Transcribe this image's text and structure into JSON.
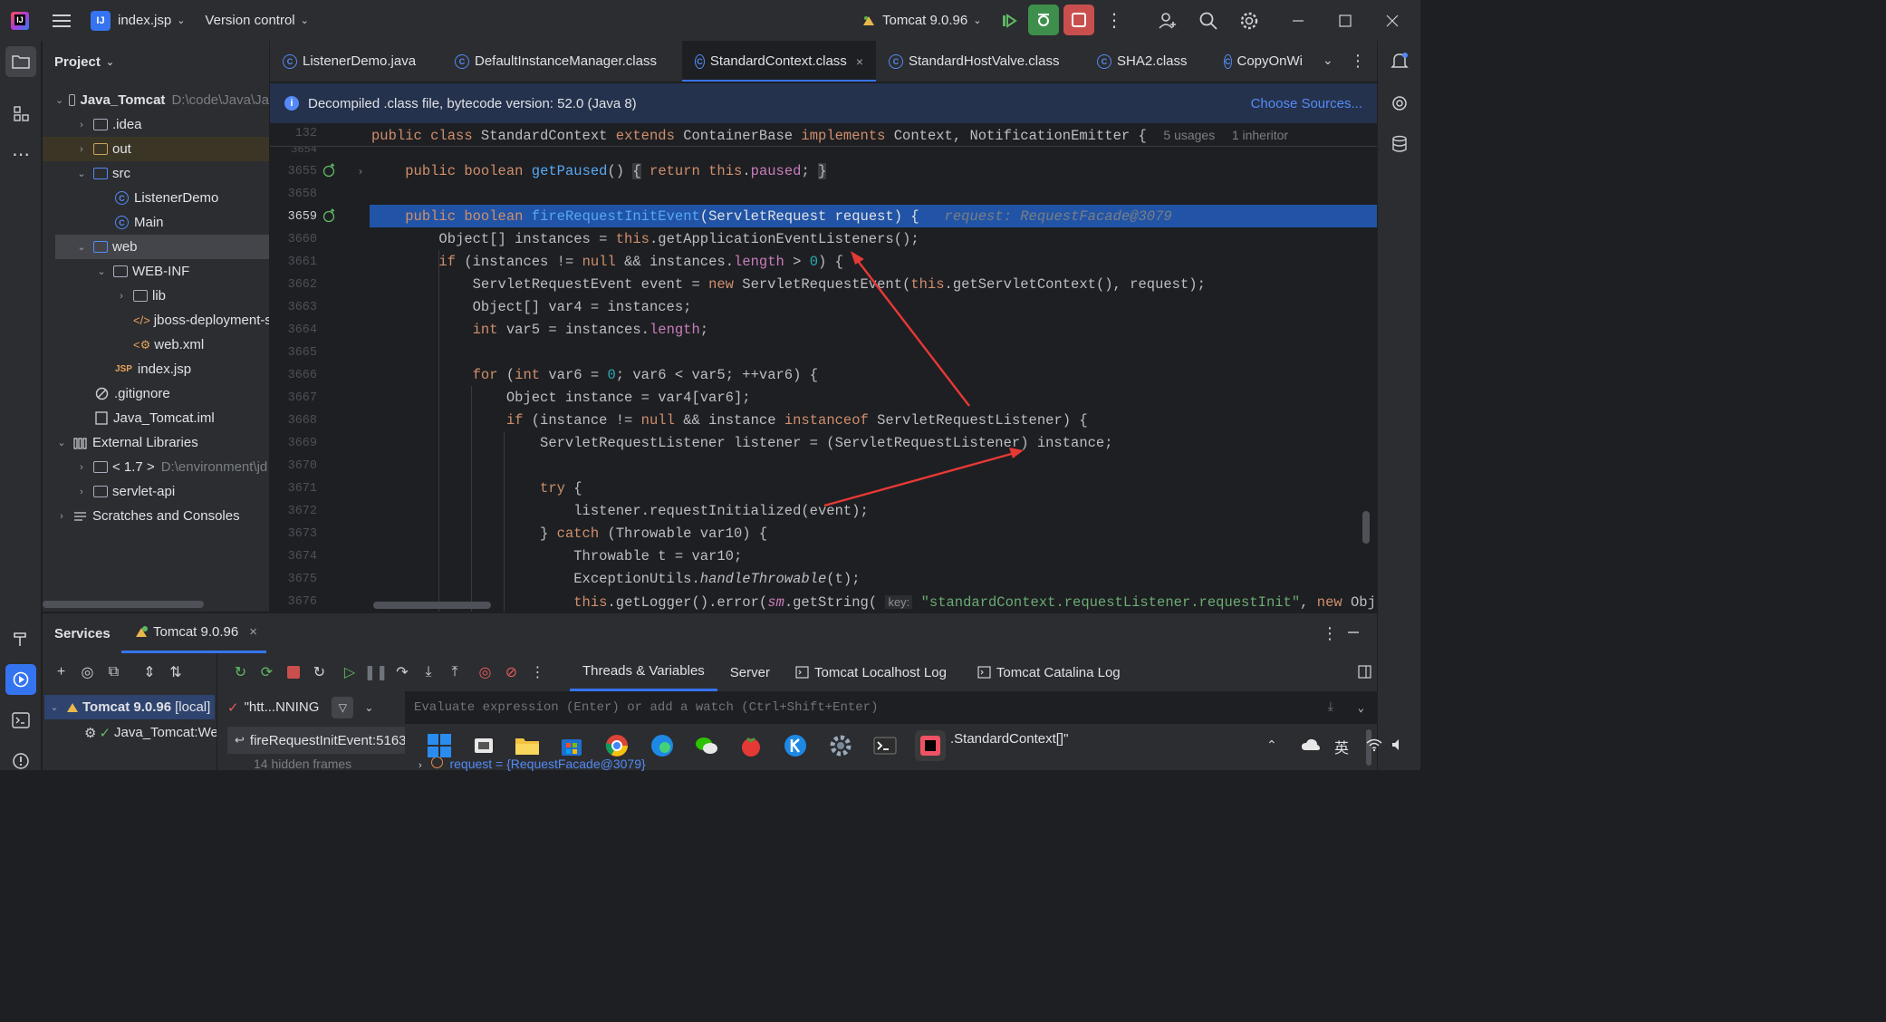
{
  "titlebar": {
    "project_name": "index.jsp",
    "project_badge": "IJ",
    "vcs_label": "Version control",
    "run_config": "Tomcat 9.0.96"
  },
  "project_panel": {
    "title": "Project",
    "items": [
      {
        "label": "Java_Tomcat",
        "path": "D:\\code\\Java\\Ja"
      },
      {
        "label": ".idea"
      },
      {
        "label": "out"
      },
      {
        "label": "src"
      },
      {
        "label": "ListenerDemo"
      },
      {
        "label": "Main"
      },
      {
        "label": "web"
      },
      {
        "label": "WEB-INF"
      },
      {
        "label": "lib"
      },
      {
        "label": "jboss-deployment-s"
      },
      {
        "label": "web.xml"
      },
      {
        "label": "index.jsp"
      },
      {
        "label": ".gitignore"
      },
      {
        "label": "Java_Tomcat.iml"
      },
      {
        "label": "External Libraries"
      },
      {
        "label": "< 1.7 >",
        "path": "D:\\environment\\jd"
      },
      {
        "label": "servlet-api"
      },
      {
        "label": "Scratches and Consoles"
      }
    ]
  },
  "tabs": [
    {
      "label": "ListenerDemo.java"
    },
    {
      "label": "DefaultInstanceManager.class"
    },
    {
      "label": "StandardContext.class"
    },
    {
      "label": "StandardHostValve.class"
    },
    {
      "label": "SHA2.class"
    },
    {
      "label": "CopyOnWi"
    }
  ],
  "banner": {
    "text": "Decompiled .class file, bytecode version: 52.0 (Java 8)",
    "link": "Choose Sources..."
  },
  "sticky": {
    "line_number": "132",
    "usages": "5 usages",
    "inheritor": "1 inheritor"
  },
  "line_numbers": [
    "3654",
    "3655",
    "3658",
    "3659",
    "3660",
    "3661",
    "3662",
    "3663",
    "3664",
    "3665",
    "3666",
    "3667",
    "3668",
    "3669",
    "3670",
    "3671",
    "3672",
    "3673",
    "3674",
    "3675",
    "3676"
  ],
  "inline_hint": "request: RequestFacade@3079",
  "param_hint": "key:",
  "string_literal": "\"standardContext.requestListener.requestInit\"",
  "services": {
    "title": "Services",
    "tab": "Tomcat 9.0.96",
    "tree_server": "Tomcat 9.0.96",
    "tree_server_suffix": "[local]",
    "tree_artifact": "Java_Tomcat:We",
    "thread_label": "\"htt...NNING",
    "frame": "fireRequestInitEvent:5163",
    "hidden_frames": "14 hidden frames",
    "tabs": [
      "Threads & Variables",
      "Server",
      "Tomcat Localhost Log",
      "Tomcat Catalina Log"
    ],
    "eval_placeholder": "Evaluate expression (Enter) or add a watch (Ctrl+Shift+Enter)",
    "var_text": ".StandardContext[]\"",
    "var_request": "request = {RequestFacade@3079}"
  },
  "taskbar": {
    "lang": "英"
  },
  "colors": {
    "accent": "#3574f0",
    "highlight_line": "#2154a6",
    "arrow": "#e53935"
  }
}
